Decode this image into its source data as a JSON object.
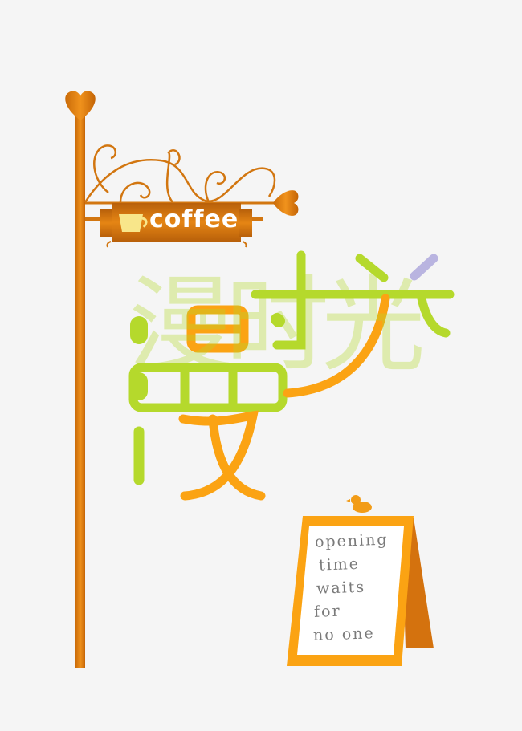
{
  "sign": {
    "label": "coffee",
    "icon": "coffee-cup-icon"
  },
  "title": {
    "text": "漫时光"
  },
  "board": {
    "lines": [
      "opening",
      "time",
      "waits",
      "for",
      "no one"
    ]
  },
  "colors": {
    "pole": "#d7770f",
    "orange": "#fba313",
    "green": "#b5d92c",
    "lavender": "#b9b4e0",
    "board_dark": "#d4720e"
  }
}
